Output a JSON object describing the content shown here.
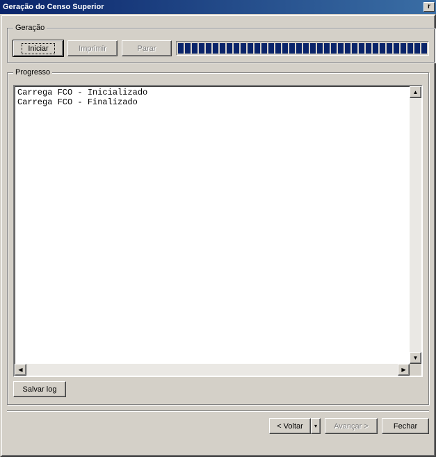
{
  "window": {
    "title": "Geração do Censo Superior",
    "close_glyph": "r"
  },
  "geracao": {
    "legend": "Geração",
    "iniciar_label": "Iniciar",
    "imprimir_label": "Imprimir",
    "parar_label": "Parar",
    "progress_segments": 36,
    "progress_filled": 36
  },
  "progresso": {
    "legend": "Progresso",
    "log_lines": [
      "Carrega FCO - Inicializado",
      "Carrega FCO - Finalizado"
    ],
    "salvar_log_label": "Salvar log"
  },
  "footer": {
    "voltar_label": "< Voltar",
    "voltar_drop_glyph": "▾",
    "avancar_label": "Avançar >",
    "fechar_label": "Fechar"
  },
  "scroll": {
    "up_glyph": "▲",
    "down_glyph": "▼",
    "left_glyph": "◀",
    "right_glyph": "▶"
  }
}
